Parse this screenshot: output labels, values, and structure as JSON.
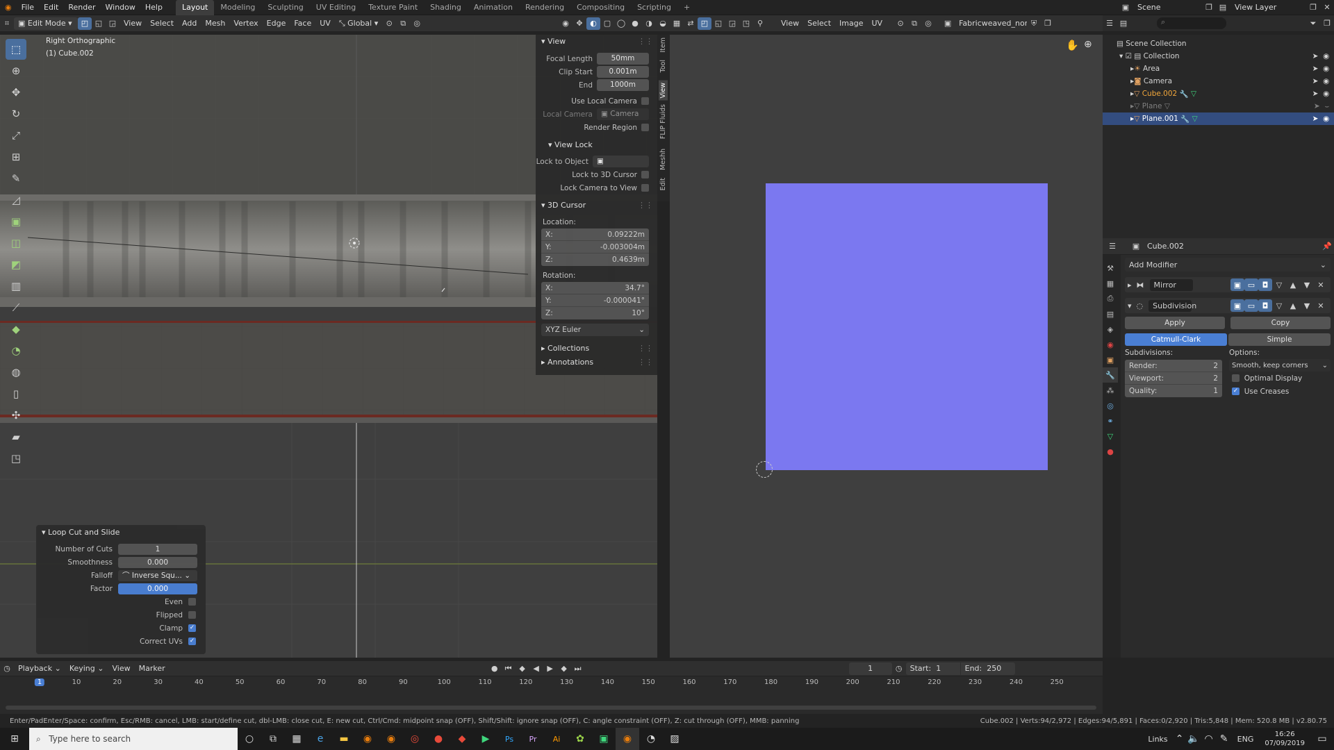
{
  "topbar": {
    "menus": [
      "File",
      "Edit",
      "Render",
      "Window",
      "Help"
    ],
    "workspaces": [
      "Layout",
      "Modeling",
      "Sculpting",
      "UV Editing",
      "Texture Paint",
      "Shading",
      "Animation",
      "Rendering",
      "Compositing",
      "Scripting"
    ],
    "active_workspace": "Layout",
    "add_tab": "+",
    "scene_label": "Scene",
    "view_layer_label": "View Layer"
  },
  "viewport_header": {
    "mode": "Edit Mode",
    "menus": [
      "View",
      "Select",
      "Add",
      "Mesh",
      "Vertex",
      "Edge",
      "Face",
      "UV"
    ],
    "orientation": "Global"
  },
  "viewport": {
    "view_name": "Right Orthographic",
    "object_name": "(1) Cube.002"
  },
  "npanel": {
    "view_section": "View",
    "focal_length_label": "Focal Length",
    "focal_length": "50mm",
    "clip_start_label": "Clip Start",
    "clip_start": "0.001m",
    "end_label": "End",
    "end": "1000m",
    "use_local_camera": "Use Local Camera",
    "local_camera_label": "Local Camera",
    "local_camera_value": "Camera",
    "render_region": "Render Region",
    "view_lock_section": "View Lock",
    "lock_to_object": "Lock to Object",
    "lock_to_3d_cursor": "Lock to 3D Cursor",
    "lock_camera_to_view": "Lock Camera to View",
    "cursor_section": "3D Cursor",
    "location_label": "Location:",
    "loc_x": "0.09222m",
    "loc_y": "-0.003004m",
    "loc_z": "0.4639m",
    "rotation_label": "Rotation:",
    "rot_x": "34.7°",
    "rot_y": "-0.000041°",
    "rot_z": "10°",
    "euler": "XYZ Euler",
    "collections": "Collections",
    "annotations": "Annotations",
    "axis_x": "X:",
    "axis_y": "Y:",
    "axis_z": "Z:",
    "side_tabs": [
      "Item",
      "Tool",
      "View",
      "FLIP Fluids",
      "Meshh",
      "Edit"
    ]
  },
  "image_editor_header": {
    "menus": [
      "View",
      "Select",
      "Image",
      "UV"
    ],
    "image_name": "Fabricweaved_nor..."
  },
  "image_editor": {
    "texture_color": "#7b78f0"
  },
  "outliner": {
    "root": "Scene Collection",
    "collection": "Collection",
    "items": [
      {
        "name": "Area"
      },
      {
        "name": "Camera"
      },
      {
        "name": "Cube.002"
      },
      {
        "name": "Plane"
      },
      {
        "name": "Plane.001"
      }
    ]
  },
  "properties": {
    "object_name": "Cube.002",
    "add_modifier": "Add Modifier",
    "mirror": "Mirror",
    "subdivision": "Subdivision",
    "apply": "Apply",
    "copy": "Copy",
    "catmull_clark": "Catmull-Clark",
    "simple": "Simple",
    "subdivisions_label": "Subdivisions:",
    "options_label": "Options:",
    "render_label": "Render:",
    "render_value": "2",
    "viewport_label": "Viewport:",
    "viewport_value": "2",
    "quality_label": "Quality:",
    "quality_value": "1",
    "uv_smooth": "Smooth, keep corners",
    "optimal_display": "Optimal Display",
    "use_creases": "Use Creases"
  },
  "loopcut": {
    "title": "Loop Cut and Slide",
    "number_of_cuts_label": "Number of Cuts",
    "number_of_cuts": "1",
    "smoothness_label": "Smoothness",
    "smoothness": "0.000",
    "falloff_label": "Falloff",
    "falloff": "Inverse Squ...",
    "factor_label": "Factor",
    "factor": "0.000",
    "even": "Even",
    "flipped": "Flipped",
    "clamp": "Clamp",
    "correct_uvs": "Correct UVs"
  },
  "timeline": {
    "menus": [
      "Playback",
      "Keying",
      "View",
      "Marker"
    ],
    "current_frame": "1",
    "start_label": "Start:",
    "start": "1",
    "end_label": "End:",
    "end": "250",
    "ruler": [
      "1",
      "10",
      "20",
      "30",
      "40",
      "50",
      "60",
      "70",
      "80",
      "90",
      "100",
      "110",
      "120",
      "130",
      "140",
      "150",
      "160",
      "170",
      "180",
      "190",
      "200",
      "210",
      "220",
      "230",
      "240",
      "250"
    ]
  },
  "status": {
    "hint": "Enter/PadEnter/Space: confirm, Esc/RMB: cancel, LMB: start/define cut, dbl-LMB: close cut, E: new cut, Ctrl/Cmd: midpoint snap (OFF), Shift/Shift: ignore snap (OFF), C: angle constraint (OFF), Z: cut through (OFF), MMB: panning",
    "stats": "Cube.002 | Verts:94/2,972 | Edges:94/5,891 | Faces:0/2,920 | Tris:5,848 | Mem: 520.8 MB | v2.80.75"
  },
  "taskbar": {
    "search_placeholder": "Type here to search",
    "links": "Links",
    "lang": "ENG",
    "time": "16:26",
    "date": "07/09/2019"
  }
}
